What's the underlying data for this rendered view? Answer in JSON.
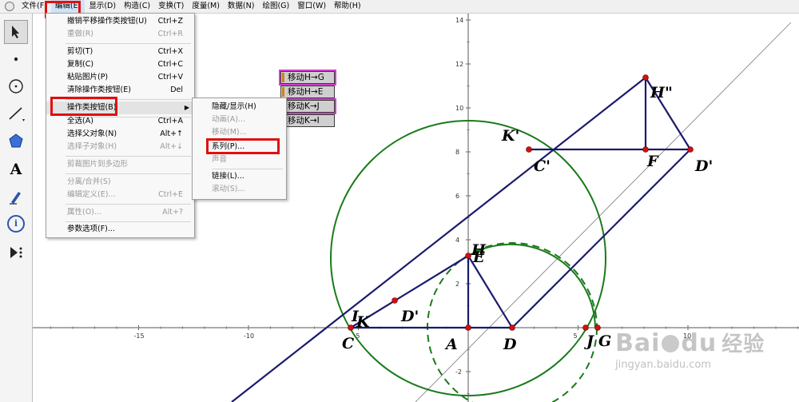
{
  "menubar": {
    "items": [
      {
        "label": "文件(F)"
      },
      {
        "label": "编辑(E)"
      },
      {
        "label": "显示(D)"
      },
      {
        "label": "构造(C)"
      },
      {
        "label": "变换(T)"
      },
      {
        "label": "度量(M)"
      },
      {
        "label": "数据(N)"
      },
      {
        "label": "绘图(G)"
      },
      {
        "label": "窗口(W)"
      },
      {
        "label": "帮助(H)"
      }
    ]
  },
  "toolbar": {
    "tools": [
      {
        "icon": "arrow-select-icon"
      },
      {
        "icon": "point-icon"
      },
      {
        "icon": "compass-icon"
      },
      {
        "icon": "straightedge-icon"
      },
      {
        "icon": "polygon-icon"
      },
      {
        "icon": "text-icon",
        "glyph": "A"
      },
      {
        "icon": "marker-icon"
      },
      {
        "icon": "information-icon",
        "glyph": "i"
      },
      {
        "icon": "custom-tool-icon"
      }
    ]
  },
  "edit_menu": {
    "items": [
      {
        "label": "撤销平移操作类按钮(U)",
        "shortcut": "Ctrl+Z",
        "disabled": false
      },
      {
        "label": "重做(R)",
        "shortcut": "Ctrl+R",
        "disabled": true
      },
      {
        "label": "剪切(T)",
        "shortcut": "Ctrl+X",
        "disabled": false
      },
      {
        "label": "复制(C)",
        "shortcut": "Ctrl+C",
        "disabled": false
      },
      {
        "label": "粘贴图片(P)",
        "shortcut": "Ctrl+V",
        "disabled": false
      },
      {
        "label": "清除操作类按钮(E)",
        "shortcut": "Del",
        "disabled": false
      },
      {
        "label": "操作类按钮(B)",
        "shortcut": "",
        "disabled": false,
        "submenu": true
      },
      {
        "label": "全选(A)",
        "shortcut": "Ctrl+A",
        "disabled": false
      },
      {
        "label": "选择父对象(N)",
        "shortcut": "Alt+↑",
        "disabled": false
      },
      {
        "label": "选择子对象(H)",
        "shortcut": "Alt+↓",
        "disabled": true
      },
      {
        "label": "剪裁图片到多边形",
        "shortcut": "",
        "disabled": true
      },
      {
        "label": "分离/合并(S)",
        "shortcut": "",
        "disabled": true
      },
      {
        "label": "编辑定义(E)...",
        "shortcut": "Ctrl+E",
        "disabled": true
      },
      {
        "label": "属性(O)...",
        "shortcut": "Alt+?",
        "disabled": true
      },
      {
        "label": "参数选项(F)...",
        "shortcut": "",
        "disabled": false
      }
    ]
  },
  "action_submenu": {
    "items": [
      {
        "label": "隐藏/显示(H)",
        "disabled": false
      },
      {
        "label": "动画(A)...",
        "disabled": true
      },
      {
        "label": "移动(M)...",
        "disabled": true
      },
      {
        "label": "系列(P)...",
        "disabled": false
      },
      {
        "label": "声音",
        "disabled": true
      },
      {
        "label": "链接(L)...",
        "disabled": false
      },
      {
        "label": "滚动(S)...",
        "disabled": true
      }
    ]
  },
  "action_buttons": [
    {
      "label": "移动H→G"
    },
    {
      "label": "移动H→E"
    },
    {
      "label": "移动K→J"
    },
    {
      "label": "移动K→I"
    }
  ],
  "graph": {
    "x_ticks": [
      "-15",
      "-10",
      "-5",
      "5",
      "10"
    ],
    "y_ticks": [
      "14",
      "12",
      "10",
      "8",
      "6",
      "4",
      "2",
      "-2"
    ],
    "point_labels": {
      "H2": "H\"",
      "Kp": "K'",
      "Cp": "C'",
      "F": "F",
      "Dp": "D'",
      "H": "H",
      "E": "E",
      "Dp2": "D'",
      "I": "I",
      "K": "K",
      "C": "C",
      "A": "A",
      "D": "D",
      "J": "J",
      "G": "G"
    },
    "colors": {
      "segment": "#1a1a6e",
      "circle": "#1a7a1a",
      "point": "#d01010",
      "axis": "#555555",
      "highlight": "#e01010"
    }
  },
  "watermark": {
    "brand": "Bai",
    "brand2": "du",
    "cn": "经验",
    "url": "jingyan.baidu.com"
  }
}
